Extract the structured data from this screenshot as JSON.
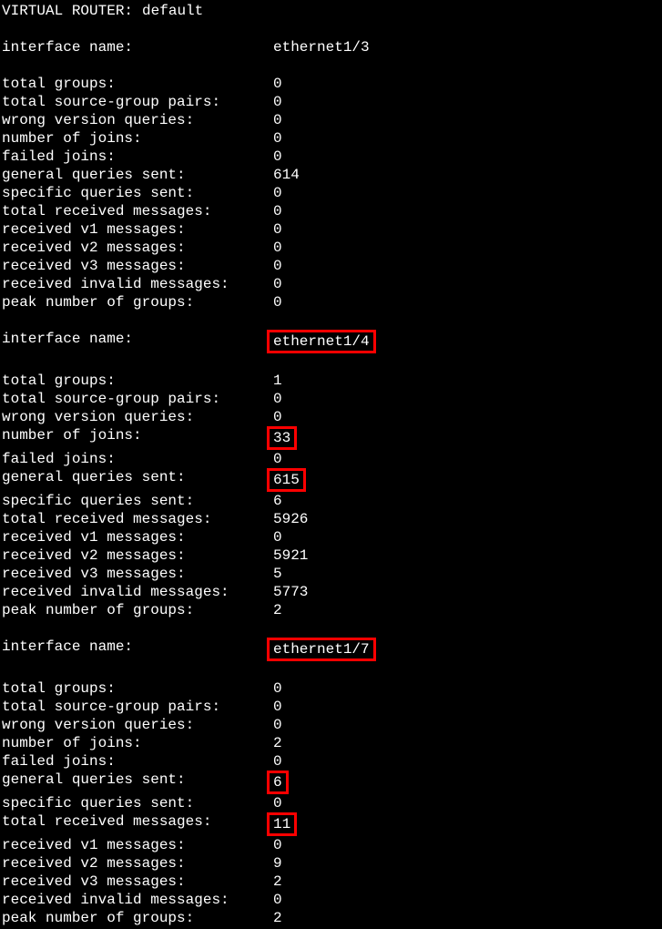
{
  "header": {
    "label": "VIRTUAL ROUTER:",
    "value": "default"
  },
  "labels": {
    "interface_name": "interface name:",
    "total_groups": "total groups:",
    "total_source_group_pairs": "total source-group pairs:",
    "wrong_version_queries": "wrong version queries:",
    "number_of_joins": "number of joins:",
    "failed_joins": "failed joins:",
    "general_queries_sent": "general queries sent:",
    "specific_queries_sent": "specific queries sent:",
    "total_received_messages": "total received messages:",
    "received_v1_messages": "received v1 messages:",
    "received_v2_messages": "received v2 messages:",
    "received_v3_messages": "received v3 messages:",
    "received_invalid_messages": "received invalid messages:",
    "peak_number_of_groups": "peak number of groups:"
  },
  "interfaces": [
    {
      "name": "ethernet1/3",
      "name_highlight": false,
      "stats": {
        "total_groups": "0",
        "total_source_group_pairs": "0",
        "wrong_version_queries": "0",
        "number_of_joins": "0",
        "failed_joins": "0",
        "general_queries_sent": "614",
        "specific_queries_sent": "0",
        "total_received_messages": "0",
        "received_v1_messages": "0",
        "received_v2_messages": "0",
        "received_v3_messages": "0",
        "received_invalid_messages": "0",
        "peak_number_of_groups": "0"
      },
      "highlights": {}
    },
    {
      "name": "ethernet1/4",
      "name_highlight": true,
      "stats": {
        "total_groups": "1",
        "total_source_group_pairs": "0",
        "wrong_version_queries": "0",
        "number_of_joins": "33",
        "failed_joins": "0",
        "general_queries_sent": "615",
        "specific_queries_sent": "6",
        "total_received_messages": "5926",
        "received_v1_messages": "0",
        "received_v2_messages": "5921",
        "received_v3_messages": "5",
        "received_invalid_messages": "5773",
        "peak_number_of_groups": "2"
      },
      "highlights": {
        "number_of_joins": true,
        "general_queries_sent": true
      }
    },
    {
      "name": "ethernet1/7",
      "name_highlight": true,
      "stats": {
        "total_groups": "0",
        "total_source_group_pairs": "0",
        "wrong_version_queries": "0",
        "number_of_joins": "2",
        "failed_joins": "0",
        "general_queries_sent": "6",
        "specific_queries_sent": "0",
        "total_received_messages": "11",
        "received_v1_messages": "0",
        "received_v2_messages": "9",
        "received_v3_messages": "2",
        "received_invalid_messages": "0",
        "peak_number_of_groups": "2"
      },
      "highlights": {
        "general_queries_sent": true,
        "total_received_messages": true
      }
    }
  ]
}
